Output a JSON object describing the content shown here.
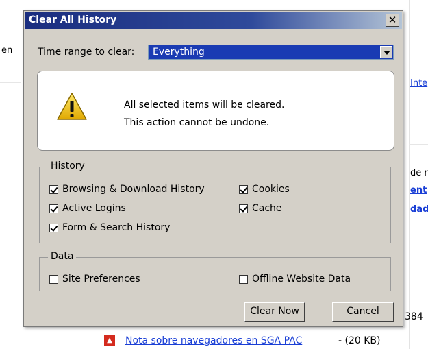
{
  "background": {
    "left_fragment": "en",
    "right_link_1": "Inte",
    "right_text_de": "de r",
    "right_link_2": "ent",
    "right_link_3": "dade",
    "right_count": "384",
    "bottom_link": "Nota sobre navegadores en SGA PAC",
    "bottom_size": "- (20 KB)"
  },
  "dialog": {
    "title": "Clear All History",
    "close_glyph": "✕",
    "time_range_label": "Time range to clear:",
    "time_range_value": "Everything",
    "warning_line1": "All selected items will be cleared.",
    "warning_line2": "This action cannot be undone.",
    "history": {
      "legend": "History",
      "items": [
        {
          "label": "Browsing & Download History",
          "checked": true
        },
        {
          "label": "Cookies",
          "checked": true
        },
        {
          "label": "Active Logins",
          "checked": true
        },
        {
          "label": "Cache",
          "checked": true
        },
        {
          "label": "Form & Search History",
          "checked": true
        }
      ]
    },
    "data": {
      "legend": "Data",
      "items": [
        {
          "label": "Site Preferences",
          "checked": false
        },
        {
          "label": "Offline Website Data",
          "checked": false
        }
      ]
    },
    "buttons": {
      "clear_now": "Clear Now",
      "cancel": "Cancel"
    }
  },
  "colors": {
    "dialog_bg": "#d4d0c8",
    "title_bar": "#1a2d7f",
    "select_highlight": "#1a3bb3",
    "link": "#1a3fd6"
  }
}
